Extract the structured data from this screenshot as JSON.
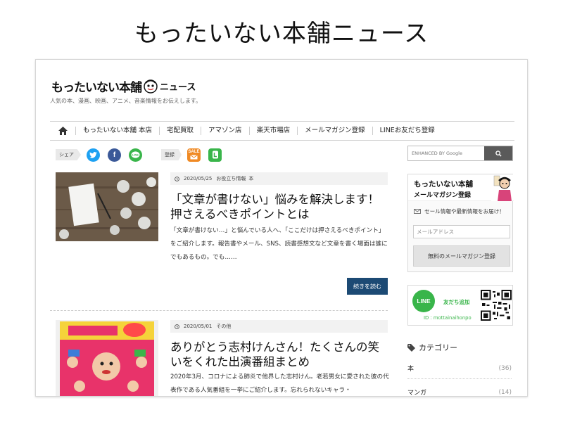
{
  "page_title": "もったいない本舗ニュース",
  "site": {
    "logo_text": "もったいない本舗",
    "logo_suffix": "ニュース",
    "tagline": "人気の本、漫画、映画、アニメ、音楽情報をお伝えします。"
  },
  "nav": {
    "home_icon": "home-icon",
    "items": [
      {
        "label": "もったいない本舗 本店"
      },
      {
        "label": "宅配買取"
      },
      {
        "label": "アマゾン店"
      },
      {
        "label": "楽天市場店"
      },
      {
        "label": "メールマガジン登録"
      },
      {
        "label": "LINEお友だち登録"
      }
    ]
  },
  "share": {
    "share_label": "シェア",
    "register_label": "登録",
    "icons": [
      "twitter-icon",
      "facebook-icon",
      "line-icon",
      "mail-sale-icon",
      "line-register-icon"
    ],
    "sale_text": "SALE"
  },
  "articles": [
    {
      "date": "2020/05/25",
      "categories": [
        "お役立ち情報",
        "本"
      ],
      "title": "「文章が書けない」悩みを解決します！押さえるべきポイントとは",
      "excerpt": "「文章が書けない…」と悩んでいる人へ、「ここだけは押さえるべきポイント」をご紹介します。報告書やメール、SNS、読書感想文など文章を書く場面は誰にでもあるもの。でも……",
      "more_label": "続きを読む"
    },
    {
      "date": "2020/05/01",
      "categories": [
        "その他"
      ],
      "title": "ありがとう志村けんさん！たくさんの笑いをくれた出演番組まとめ",
      "excerpt": "2020年3月、コロナによる肺炎で他界した志村けん。老若男女に愛された彼の代表作である人気番組を一挙にご紹介します。忘れられないキャラ・"
    }
  ],
  "sidebar": {
    "search_placeholder": "ENHANCED BY Google",
    "mailmag": {
      "logo": "もったいない本舗",
      "title": "メールマガジン登録",
      "desc": "セール情報や最新情報をお届け！",
      "input_placeholder": "メールアドレス",
      "button": "無料のメールマガジン登録"
    },
    "line": {
      "logo": "LINE",
      "add_label": "友だち追加",
      "id": "ID : mottainaihonpo"
    },
    "categories_title": "カテゴリー",
    "categories": [
      {
        "name": "本",
        "count": "(36)"
      },
      {
        "name": "マンガ",
        "count": "(14)"
      }
    ]
  },
  "colors": {
    "twitter": "#1da1f2",
    "facebook": "#3b5998",
    "line": "#39b54a",
    "more_button": "#1c4a74"
  }
}
